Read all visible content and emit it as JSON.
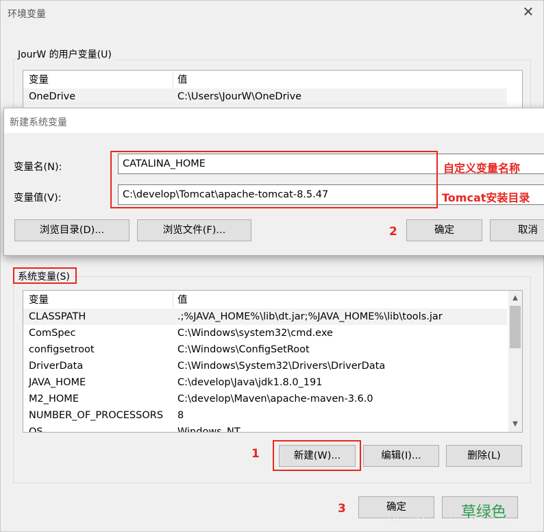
{
  "window": {
    "title": "环境变量"
  },
  "user_vars": {
    "group_label": "JourW 的用户变量(U)",
    "columns": [
      "变量",
      "值"
    ],
    "rows": [
      {
        "name": "OneDrive",
        "value": "C:\\Users\\JourW\\OneDrive"
      }
    ]
  },
  "dialog": {
    "title": "新建系统变量",
    "name_label": "变量名(N):",
    "name_value": "CATALINA_HOME",
    "value_label": "变量值(V):",
    "value_value": "C:\\develop\\Tomcat\\apache-tomcat-8.5.47",
    "browse_dir": "浏览目录(D)...",
    "browse_file": "浏览文件(F)...",
    "ok": "确定",
    "cancel": "取消"
  },
  "annotations": {
    "name_hint": "自定义变量名称",
    "value_hint": "Tomcat安装目录",
    "step1": "1",
    "step2": "2",
    "step3": "3",
    "color_text": "草绿色",
    "watermark": "https://blog.csdn.net/ThinkWon",
    "accent_color": "#e8261f"
  },
  "system_vars": {
    "group_label": "系统变量(S)",
    "columns": [
      "变量",
      "值"
    ],
    "rows": [
      {
        "name": "CLASSPATH",
        "value": ".;%JAVA_HOME%\\lib\\dt.jar;%JAVA_HOME%\\lib\\tools.jar"
      },
      {
        "name": "ComSpec",
        "value": "C:\\Windows\\system32\\cmd.exe"
      },
      {
        "name": "configsetroot",
        "value": "C:\\Windows\\ConfigSetRoot"
      },
      {
        "name": "DriverData",
        "value": "C:\\Windows\\System32\\Drivers\\DriverData"
      },
      {
        "name": "JAVA_HOME",
        "value": "C:\\develop\\Java\\jdk1.8.0_191"
      },
      {
        "name": "M2_HOME",
        "value": "C:\\develop\\Maven\\apache-maven-3.6.0"
      },
      {
        "name": "NUMBER_OF_PROCESSORS",
        "value": "8"
      },
      {
        "name": "OS",
        "value": "Windows_NT"
      }
    ],
    "new_button": "新建(W)...",
    "edit_button": "编辑(I)...",
    "delete_button": "删除(L)"
  },
  "footer": {
    "ok": "确定"
  }
}
